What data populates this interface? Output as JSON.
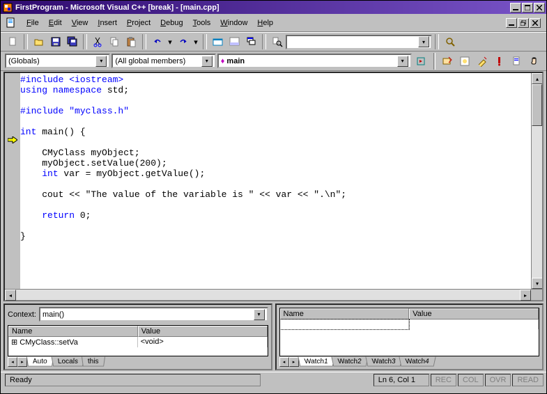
{
  "window": {
    "title": "FirstProgram - Microsoft Visual C++ [break] - [main.cpp]"
  },
  "menu": {
    "items": [
      "File",
      "Edit",
      "View",
      "Insert",
      "Project",
      "Debug",
      "Tools",
      "Window",
      "Help"
    ],
    "underline_idx": [
      0,
      0,
      0,
      0,
      0,
      0,
      0,
      0,
      0
    ]
  },
  "toolbar2": {
    "scope": "(Globals)",
    "members": "(All global members)",
    "func": "main"
  },
  "code": {
    "lines": [
      {
        "t": "#include <iostream>",
        "cls": "pp"
      },
      {
        "t": "using namespace std;",
        "spans": [
          [
            "kw",
            "using namespace"
          ],
          [
            "",
            " std;"
          ]
        ]
      },
      {
        "t": ""
      },
      {
        "t": "#include \"myclass.h\"",
        "cls": "pp"
      },
      {
        "t": ""
      },
      {
        "t": "int main() {",
        "spans": [
          [
            "kw",
            "int"
          ],
          [
            "",
            " main() {"
          ]
        ]
      },
      {
        "t": ""
      },
      {
        "t": "    CMyClass myObject;"
      },
      {
        "t": "    myObject.setValue(200);"
      },
      {
        "t": "    int var = myObject.getValue();",
        "spans": [
          [
            "",
            "    "
          ],
          [
            "kw",
            "int"
          ],
          [
            "",
            " var = myObject.getValue();"
          ]
        ]
      },
      {
        "t": ""
      },
      {
        "t": "    cout << \"The value of the variable is \" << var << \".\\n\";"
      },
      {
        "t": ""
      },
      {
        "t": "    return 0;",
        "spans": [
          [
            "",
            "    "
          ],
          [
            "kw",
            "return"
          ],
          [
            "",
            " 0;"
          ]
        ]
      },
      {
        "t": ""
      },
      {
        "t": "}"
      }
    ]
  },
  "left_panel": {
    "context_label": "Context:",
    "context_value": "main()",
    "headers": [
      "Name",
      "Value"
    ],
    "rows": [
      [
        "CMyClass::setVa",
        "<void>"
      ]
    ],
    "tabs": [
      "Auto",
      "Locals",
      "this"
    ],
    "active_tab": 0
  },
  "right_panel": {
    "headers": [
      "Name",
      "Value"
    ],
    "rows": [
      [
        "",
        ""
      ]
    ],
    "tabs": [
      "Watch1",
      "Watch2",
      "Watch3",
      "Watch4"
    ],
    "active_tab": 0
  },
  "statusbar": {
    "ready": "Ready",
    "pos": "Ln 6, Col 1",
    "modes": [
      "REC",
      "COL",
      "OVR",
      "READ"
    ]
  }
}
